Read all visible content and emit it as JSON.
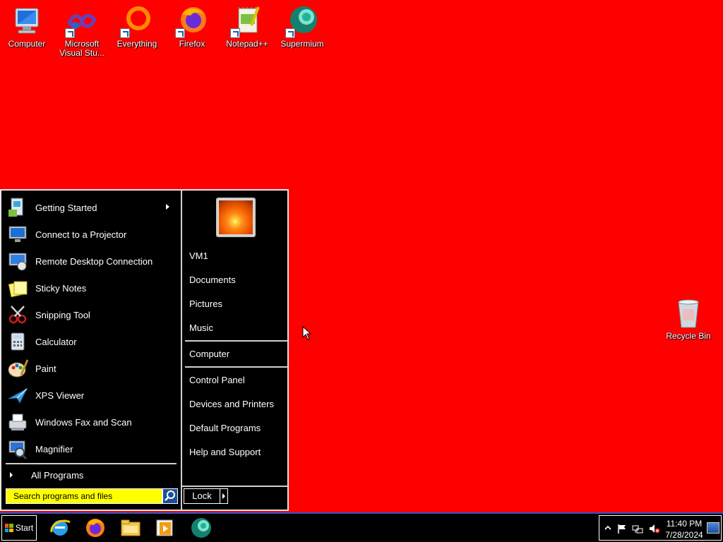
{
  "desktop": {
    "icons": [
      {
        "label": "Computer",
        "icon": "computer-icon"
      },
      {
        "label": "Microsoft Visual Stu...",
        "icon": "visual-studio-icon"
      },
      {
        "label": "Everything",
        "icon": "everything-icon"
      },
      {
        "label": "Firefox",
        "icon": "firefox-icon"
      },
      {
        "label": "Notepad++",
        "icon": "notepad-plus-plus-icon"
      },
      {
        "label": "Supermium",
        "icon": "supermium-icon"
      }
    ],
    "recycle_bin": {
      "label": "Recycle Bin",
      "icon": "recycle-bin-icon"
    },
    "background_color": "#ff0000"
  },
  "start_menu": {
    "programs": [
      {
        "label": "Getting Started",
        "icon": "getting-started-icon",
        "has_submenu": true
      },
      {
        "label": "Connect to a Projector",
        "icon": "projector-icon"
      },
      {
        "label": "Remote Desktop Connection",
        "icon": "remote-desktop-icon"
      },
      {
        "label": "Sticky Notes",
        "icon": "sticky-notes-icon"
      },
      {
        "label": "Snipping Tool",
        "icon": "snipping-tool-icon"
      },
      {
        "label": "Calculator",
        "icon": "calculator-icon"
      },
      {
        "label": "Paint",
        "icon": "paint-icon"
      },
      {
        "label": "XPS Viewer",
        "icon": "xps-viewer-icon"
      },
      {
        "label": "Windows Fax and Scan",
        "icon": "fax-scan-icon"
      },
      {
        "label": "Magnifier",
        "icon": "magnifier-icon"
      }
    ],
    "all_programs": "All Programs",
    "search_placeholder": "Search programs and files",
    "right_items": {
      "user": "VM1",
      "documents": "Documents",
      "pictures": "Pictures",
      "music": "Music",
      "computer": "Computer",
      "control_panel": "Control Panel",
      "devices_printers": "Devices and Printers",
      "default_programs": "Default Programs",
      "help_support": "Help and Support"
    },
    "lock_label": "Lock"
  },
  "taskbar": {
    "start_label": "Start",
    "pinned": [
      "internet-explorer-icon",
      "firefox-icon",
      "file-explorer-icon",
      "media-player-icon",
      "supermium-icon"
    ],
    "tray_icons": [
      "show-hidden-icon",
      "action-center-flag-icon",
      "network-icon",
      "volume-muted-icon"
    ],
    "clock_time": "11:40 PM",
    "clock_date": "7/28/2024",
    "accent_color": "#2b55c9"
  }
}
